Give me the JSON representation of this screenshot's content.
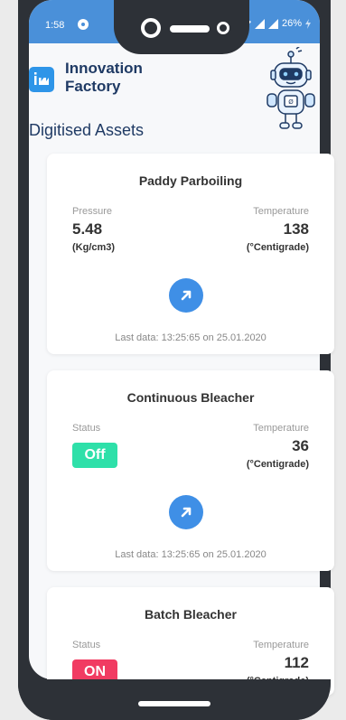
{
  "statusbar": {
    "time": "1:58",
    "battery": "26%",
    "accent": "#4a90d9"
  },
  "brand": {
    "line1": "Innovation",
    "line2": "Factory",
    "logo_color": "#2e95e8"
  },
  "page_title": "Digitised Assets",
  "assets": [
    {
      "name": "Paddy Parboiling",
      "left_label": "Pressure",
      "left_value": "5.48",
      "left_unit": "(Kg/cm3)",
      "right_label": "Temperature",
      "right_value": "138",
      "right_unit": "(°Centigrade)",
      "last_data": "Last data: 13:25:65 on 25.01.2020"
    },
    {
      "name": "Continuous Bleacher",
      "left_label": "Status",
      "status": "Off",
      "right_label": "Temperature",
      "right_value": "36",
      "right_unit": "(°Centigrade)",
      "last_data": "Last data: 13:25:65 on 25.01.2020"
    },
    {
      "name": "Batch Bleacher",
      "left_label": "Status",
      "status": "ON",
      "right_label": "Temperature",
      "right_value": "112",
      "right_unit": "(°Centigrade)"
    }
  ],
  "colors": {
    "status_off": "#2ee0a9",
    "status_on": "#f13b62",
    "action_button": "#3f8fe6",
    "title_text": "#1f3a64"
  }
}
